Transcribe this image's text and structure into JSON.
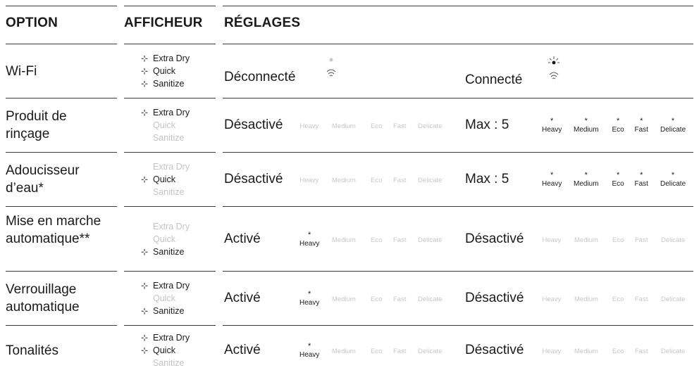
{
  "headers": {
    "option": "OPTION",
    "display": "AFFICHEUR",
    "settings": "RÉGLAGES"
  },
  "display_labels": [
    "Extra Dry",
    "Quick",
    "Sanitize"
  ],
  "modes": [
    "Heavy",
    "Medium",
    "Eco",
    "Fast",
    "Delicate"
  ],
  "sparkle_glyph": "⊹",
  "star_glyph": "*",
  "rows": [
    {
      "option": "Wi-Fi",
      "active": [
        true,
        true,
        true
      ],
      "left_status": "Déconnecté",
      "right_status": "Connecté"
    },
    {
      "option": "Produit de rinçage",
      "active": [
        true,
        false,
        false
      ],
      "left_status": "Désactivé",
      "right_status": "Max : 5"
    },
    {
      "option": "Adoucisseur d’eau*",
      "active": [
        false,
        true,
        false
      ],
      "left_status": "Désactivé",
      "right_status": "Max : 5"
    },
    {
      "option": "Mise en marche automatique**",
      "active": [
        false,
        false,
        true
      ],
      "left_status": "Activé",
      "right_status": "Désactivé"
    },
    {
      "option": "Verrouillage automatique",
      "active": [
        true,
        false,
        true
      ],
      "left_status": "Activé",
      "right_status": "Désactivé"
    },
    {
      "option": "Tonalités",
      "active": [
        true,
        true,
        false
      ],
      "left_status": "Activé",
      "right_status": "Désactivé"
    }
  ],
  "colors": {
    "text": "#1a1a1a",
    "inactive": "#c4c4c4",
    "rule": "#3a3a3a"
  }
}
